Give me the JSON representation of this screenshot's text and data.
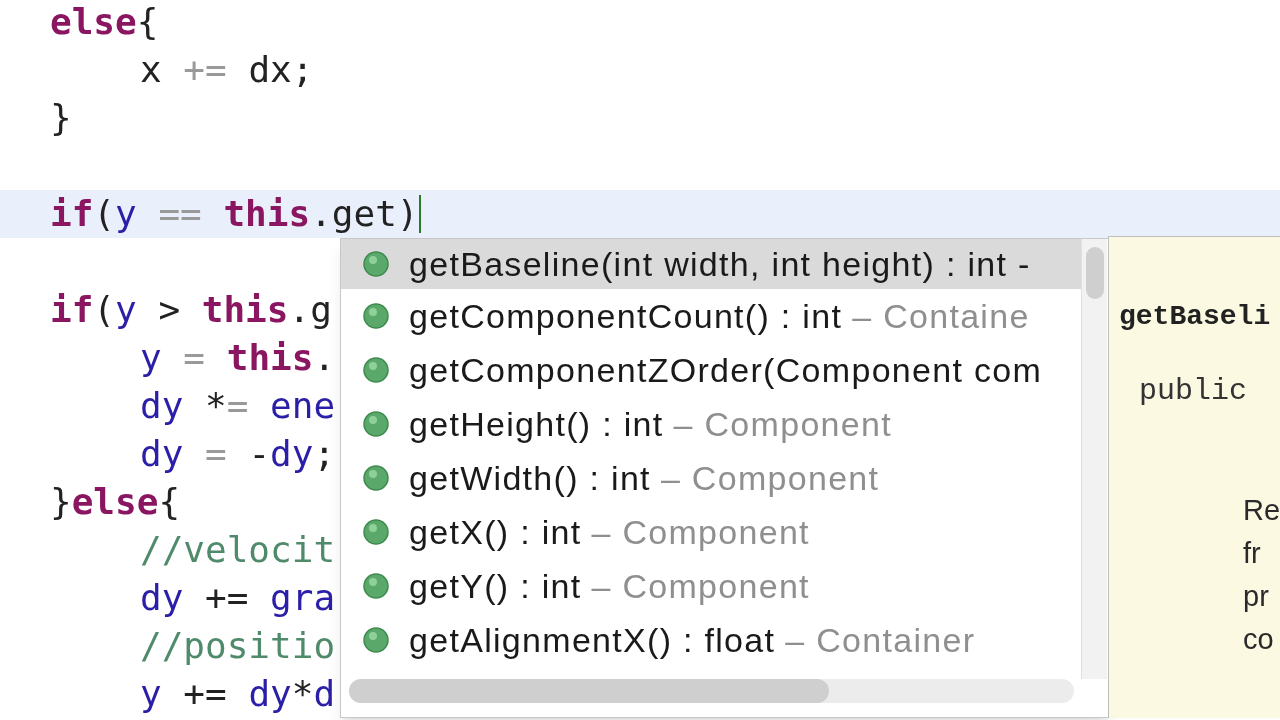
{
  "editor": {
    "lines": [
      {
        "kind": "code",
        "current": false,
        "tokens": [
          {
            "text": "else",
            "kind": "keyword"
          },
          {
            "text": "{",
            "kind": "plain"
          }
        ],
        "children": [
          {
            "kind": "code",
            "current": false,
            "tokens": [
              {
                "text": "x",
                "kind": "plain"
              },
              {
                "text": " += ",
                "kind": "op"
              },
              {
                "text": "dx",
                "kind": "plain"
              },
              {
                "text": ";",
                "kind": "plain"
              }
            ]
          }
        ]
      },
      {
        "kind": "code",
        "current": false,
        "tokens": [
          {
            "text": "}",
            "kind": "plain"
          }
        ]
      },
      {
        "kind": "blank"
      },
      {
        "kind": "code",
        "current": true,
        "tokens": [
          {
            "text": "if",
            "kind": "keyword"
          },
          {
            "text": "(",
            "kind": "plain"
          },
          {
            "text": "y",
            "kind": "field"
          },
          {
            "text": " == ",
            "kind": "op"
          },
          {
            "text": "this",
            "kind": "keyword"
          },
          {
            "text": ".get)",
            "kind": "plain"
          }
        ]
      },
      {
        "kind": "blank"
      },
      {
        "kind": "code",
        "current": false,
        "tokens": [
          {
            "text": "if",
            "kind": "keyword"
          },
          {
            "text": "(",
            "kind": "plain"
          },
          {
            "text": "y",
            "kind": "field"
          },
          {
            "text": " > ",
            "kind": "plain"
          },
          {
            "text": "this",
            "kind": "keyword"
          },
          {
            "text": ".g",
            "kind": "plain"
          }
        ],
        "children": [
          {
            "kind": "code",
            "current": false,
            "tokens": [
              {
                "text": "y",
                "kind": "field"
              },
              {
                "text": " = ",
                "kind": "op"
              },
              {
                "text": "this",
                "kind": "keyword"
              },
              {
                "text": ".",
                "kind": "plain"
              }
            ]
          },
          {
            "kind": "code",
            "current": false,
            "tokens": [
              {
                "text": "dy",
                "kind": "field"
              },
              {
                "text": " *",
                "kind": "plain"
              },
              {
                "text": "= ",
                "kind": "op"
              },
              {
                "text": "ene",
                "kind": "field"
              }
            ]
          },
          {
            "kind": "code",
            "current": false,
            "tokens": [
              {
                "text": "dy",
                "kind": "field"
              },
              {
                "text": " = ",
                "kind": "op"
              },
              {
                "text": "-",
                "kind": "plain"
              },
              {
                "text": "dy",
                "kind": "field"
              },
              {
                "text": ";",
                "kind": "plain"
              }
            ]
          }
        ]
      },
      {
        "kind": "code",
        "current": false,
        "tokens": [
          {
            "text": "}",
            "kind": "plain"
          },
          {
            "text": "else",
            "kind": "keyword"
          },
          {
            "text": "{",
            "kind": "plain"
          }
        ],
        "children": [
          {
            "kind": "code",
            "current": false,
            "tokens": [
              {
                "text": "//velocit",
                "kind": "comment"
              }
            ]
          },
          {
            "kind": "code",
            "current": false,
            "tokens": [
              {
                "text": "dy",
                "kind": "field"
              },
              {
                "text": " += ",
                "kind": "plain"
              },
              {
                "text": "gra",
                "kind": "field"
              }
            ]
          },
          {
            "kind": "code",
            "current": false,
            "tokens": [
              {
                "text": "//positio",
                "kind": "comment"
              }
            ]
          },
          {
            "kind": "code",
            "current": false,
            "tokens": [
              {
                "text": "y",
                "kind": "field"
              },
              {
                "text": " += ",
                "kind": "plain"
              },
              {
                "text": "dy",
                "kind": "field"
              },
              {
                "text": "*",
                "kind": "plain"
              },
              {
                "text": "d",
                "kind": "field"
              }
            ]
          }
        ]
      }
    ]
  },
  "completion": {
    "items": [
      {
        "name": "getBaseline(int width, int height) : int -",
        "selected": true
      },
      {
        "name": "getComponentCount() : int",
        "owner": "– Containe",
        "selected": false
      },
      {
        "name": "getComponentZOrder(Component com",
        "selected": false
      },
      {
        "name": "getHeight() : int",
        "owner": "– Component",
        "selected": false
      },
      {
        "name": "getWidth() : int",
        "owner": "– Component",
        "selected": false
      },
      {
        "name": "getX() : int",
        "owner": "– Component",
        "selected": false
      },
      {
        "name": "getY() : int",
        "owner": "– Component",
        "selected": false
      },
      {
        "name": "getAlignmentX() : float",
        "owner": "– Container",
        "selected": false
      }
    ]
  },
  "doc": {
    "title": "getBaseli",
    "signature": "public",
    "description_lines": [
      "Re",
      "fr",
      "pr",
      "co"
    ]
  }
}
